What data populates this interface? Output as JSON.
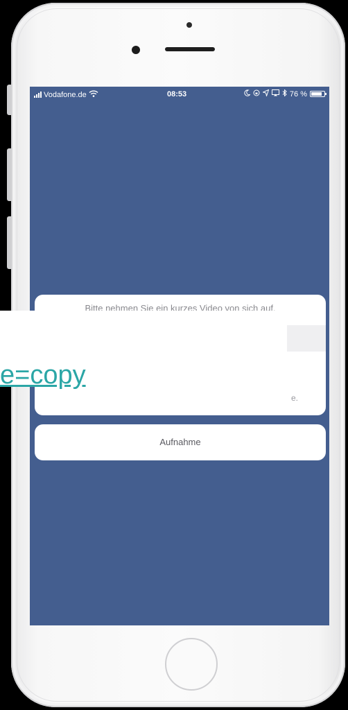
{
  "status_bar": {
    "carrier": "Vodafone.de",
    "time": "08:53",
    "battery": "76 %",
    "battery_level": 0.76,
    "icons": [
      "signal-icon",
      "wifi-icon",
      "moon-icon",
      "lock-rotation-icon",
      "location-icon",
      "airplay-icon",
      "bluetooth-icon",
      "battery-icon"
    ]
  },
  "sheet": {
    "message": "Bitte nehmen Sie ein kurzes Video von sich auf.",
    "footnote": "e."
  },
  "action": {
    "label": "Aufnahme"
  },
  "overlay": {
    "link_text": "e=copy"
  },
  "colors": {
    "screen_background": "#445e8f",
    "link": "#2ba6a6"
  }
}
